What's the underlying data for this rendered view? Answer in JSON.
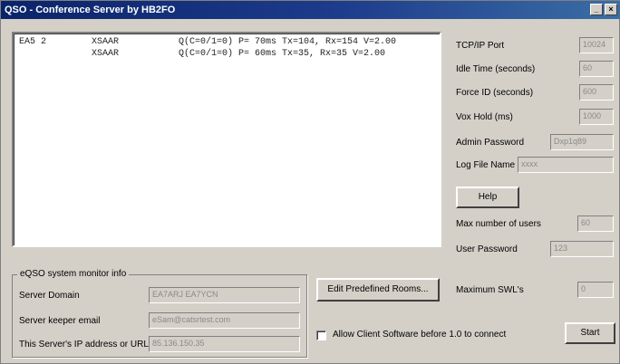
{
  "window": {
    "title": "QSO - Conference Server by HB2FO",
    "minimize": "_",
    "close": "×"
  },
  "log": {
    "lines": [
      {
        "col1": "EA5  2",
        "col2": "XSAAR",
        "col3": "Q(C=0/1=0)  P=  70ms  Tx=104, Rx=154  V=2.00"
      },
      {
        "col1": "",
        "col2": "XSAAR",
        "col3": "Q(C=0/1=0)  P=  60ms  Tx=35, Rx=35  V=2.00"
      }
    ]
  },
  "settings": {
    "tcp_port": {
      "label": "TCP/IP Port",
      "value": "10024"
    },
    "idle_time": {
      "label": "Idle Time (seconds)",
      "value": "60"
    },
    "force_id": {
      "label": "Force ID (seconds)",
      "value": "600"
    },
    "vox_hold": {
      "label": "Vox Hold (ms)",
      "value": "1000"
    },
    "admin_password": {
      "label": "Admin Password",
      "value": "Dxp1q89"
    },
    "log_file": {
      "label": "Log File Name",
      "value": "xxxx"
    },
    "help_button": "Help",
    "max_users": {
      "label": "Max number of users",
      "value": "60"
    },
    "user_password": {
      "label": "User Password",
      "value": "123"
    },
    "max_swls": {
      "label": "Maximum SWL's",
      "value": "0"
    }
  },
  "monitor": {
    "group_title": "eQSO system monitor info",
    "server_domain": {
      "label": "Server Domain",
      "value": "EA7ARJ EA7YCN"
    },
    "server_email": {
      "label": "Server keeper email",
      "value": "eSam@catsrtest.com"
    },
    "server_ip": {
      "label": "This Server's IP address or URL",
      "value": "85.136.150.35"
    }
  },
  "actions": {
    "edit_rooms": "Edit Predefined Rooms...",
    "allow_clients_label": "Allow Client Software before 1.0 to connect",
    "allow_clients_checked": false,
    "start": "Start"
  }
}
